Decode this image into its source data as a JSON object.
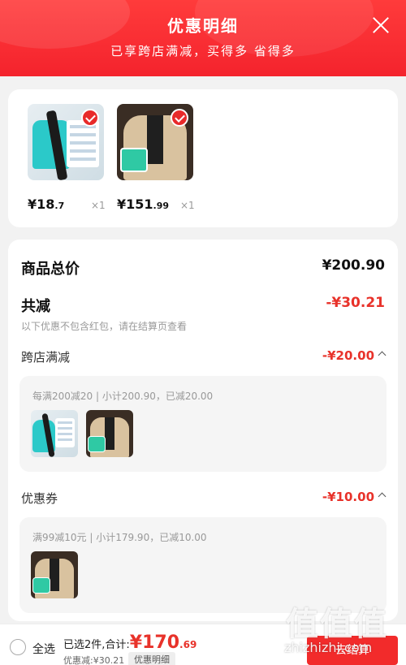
{
  "header": {
    "title": "优惠明细",
    "subtitle": "已享跨店满减，买得多 省得多"
  },
  "products": [
    {
      "name": "bag",
      "price_int": "¥18",
      "price_dec": ".7",
      "qty": "×1"
    },
    {
      "name": "jacket",
      "price_int": "¥151",
      "price_dec": ".99",
      "qty": "×1"
    }
  ],
  "summary": {
    "total_label": "商品总价",
    "total_value": "¥200.90",
    "reduce_label": "共减",
    "reduce_value": "-¥30.21",
    "note": "以下优惠不包含红包，请在结算页查看",
    "cross_store": {
      "label": "跨店满减",
      "value": "-¥20.00",
      "detail": "每满200减20 | 小计200.90，已减20.00"
    },
    "coupon": {
      "label": "优惠券",
      "value": "-¥10.00",
      "detail": "满99减10元 | 小计179.90，已减10.00"
    }
  },
  "footer": {
    "select_all": "全选",
    "selected_prefix": "已选2件,合计:",
    "total_currency": "¥",
    "total_int": "170",
    "total_dec": ".69",
    "discount": "优惠减:¥30.21",
    "detail_tag": "优惠明细",
    "checkout": "去结算"
  },
  "watermark": {
    "logo": "值值值",
    "text": "zhizhizhi.com"
  },
  "colors": {
    "header_red": "#f4232d",
    "price_red": "#e8322a",
    "checkout_red": "#f22b2b"
  }
}
